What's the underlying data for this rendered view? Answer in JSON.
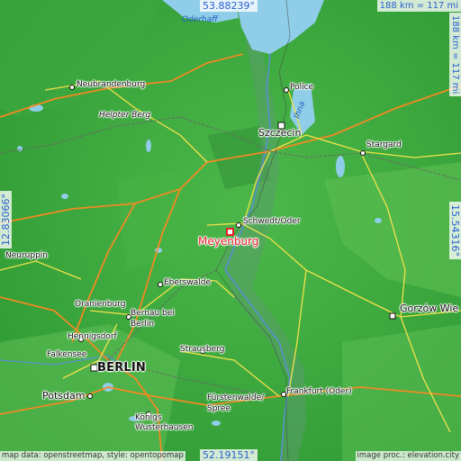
{
  "map": {
    "coords": {
      "top_lat": "53.88239°",
      "bottom_lat": "52.19151°",
      "left_lon": "12.83066°",
      "right_lon": "15.54316°"
    },
    "scale": {
      "horizontal": "188 km = 117 mi",
      "vertical": "188 km = 117 mi"
    },
    "marker": {
      "label": "Meyenburg",
      "color": "#e8202a"
    },
    "water_labels": {
      "oderhaff": "Oderhaff",
      "ihna": "Ihna"
    },
    "places": {
      "neubrandenburg": "Neubrandenburg",
      "helpter_berg": "Helpter Berg",
      "police": "Police",
      "szczecin": "Szczecin",
      "stargard": "Stargard",
      "schwedt": "Schwedt/Oder",
      "neuruppin": "Neuruppin",
      "eberswalde": "Eberswalde",
      "oranienburg": "Oranienburg",
      "bernau_1": "Bernau bei",
      "bernau_2": "Berlin",
      "hennigsdorf": "Hennigsdorf",
      "falkensee": "Falkensee",
      "berlin": "BERLIN",
      "strausberg": "Strausberg",
      "gorzow": "Gorzów Wie",
      "potsdam": "Potsdam",
      "furstenwalde_1": "Fürstenwalde/",
      "furstenwalde_2": "Spree",
      "konigs_1": "Königs",
      "konigs_2": "Wusterhausen",
      "frankfurt": "Frankfurt (Oder)"
    },
    "attribution": {
      "left": "map data: openstreetmap, style: opentopomap",
      "right": "image proc.: elevation.city"
    }
  }
}
